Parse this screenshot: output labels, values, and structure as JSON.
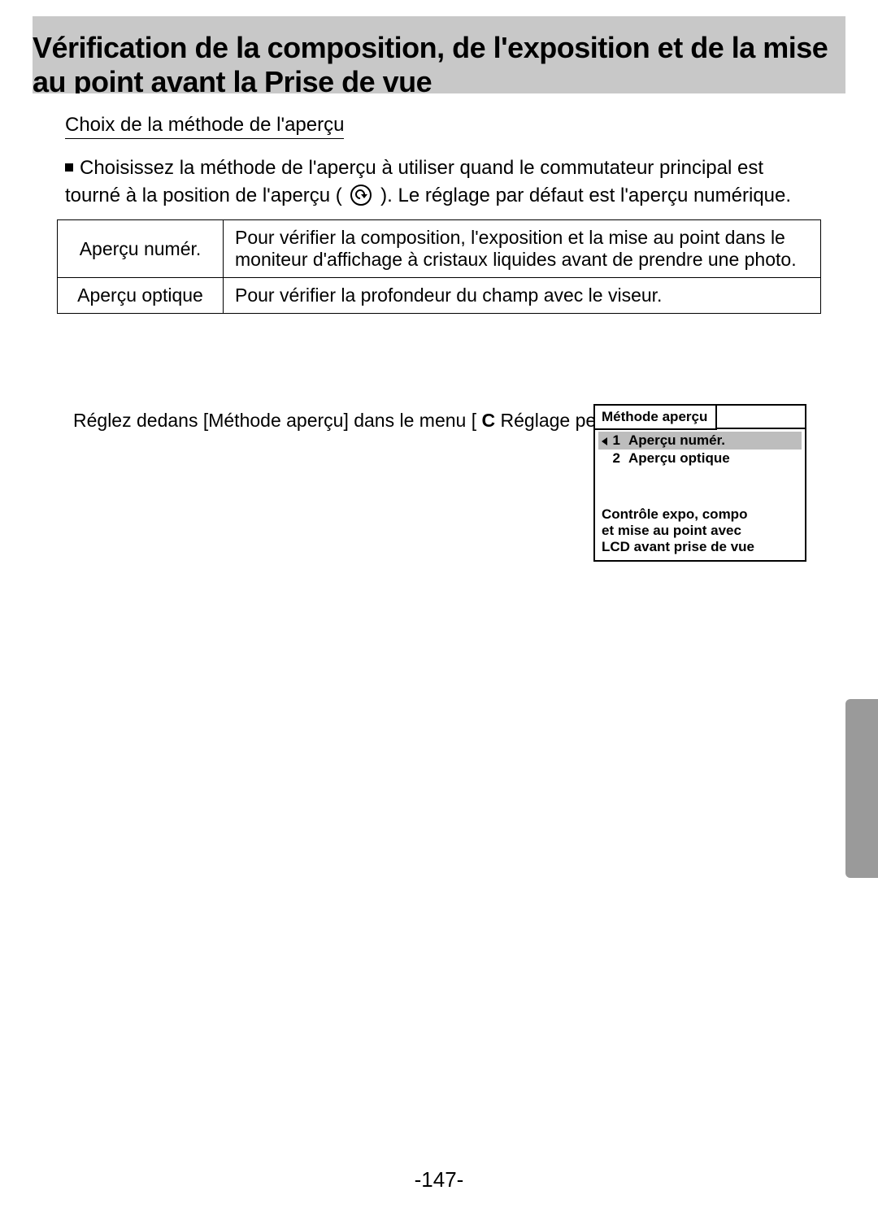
{
  "title": "Vérification de la composition, de l'exposition et de la mise au point avant la Prise de vue",
  "section_label": "Choix de la méthode de l'aperçu",
  "bullet": {
    "pre": "Choisissez la méthode de l'aperçu à utiliser quand le commutateur principal est tourné à la position de l'aperçu (",
    "post": "). Le réglage par défaut est l'aperçu numérique."
  },
  "table": {
    "row1_label": "Aperçu numér.",
    "row1_desc": "Pour vérifier la composition, l'exposition et la mise au point dans le moniteur d'affichage à cristaux liquides avant de prendre une photo.",
    "row2_label": "Aperçu optique",
    "row2_desc": "Pour vérifier la profondeur du champ avec le viseur."
  },
  "instruction": {
    "pre": "Réglez dedans [Méthode aperçu] dans le menu [",
    "c": "C",
    "post": " Réglage perso]"
  },
  "menu": {
    "tab": "Méthode aperçu",
    "item1_num": "1",
    "item1_label": "Aperçu numér.",
    "item2_num": "2",
    "item2_label": "Aperçu optique",
    "desc_line1": "Contrôle expo, compo",
    "desc_line2": "et mise au point avec",
    "desc_line3": "LCD avant prise de vue"
  },
  "page_number": "-147-"
}
